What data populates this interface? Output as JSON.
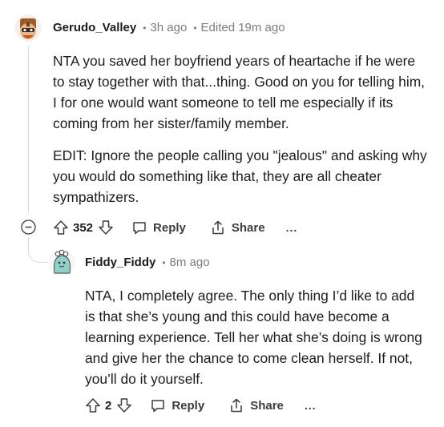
{
  "comment": {
    "author": "Gerudo_Valley",
    "age": "3h ago",
    "edited": "Edited 19m ago",
    "paragraphs": [
      "NTA you saved her boyfriend years of heartache if he were to stay together with that...thing. Good on you for telling him, I for one would want someone to tell me especially if its coming from her sister/family member.",
      "EDIT: Ignore the people calling you \"jealous\" and asking why you would do something like that, they are all cheater sympathizers."
    ],
    "votes": "352",
    "reply_label": "Reply",
    "share_label": "Share",
    "more_label": "..."
  },
  "reply": {
    "author": "Fiddy_Fiddy",
    "age": "8m ago",
    "paragraphs": [
      "NTA, I completely agree. The only thing I’d like to add is that she’s young and this could have become a learning experience. Tell her what she’s doing is wrong and give her the chance to come clean herself. If not, you’ll do it yourself."
    ],
    "votes": "2",
    "reply_label": "Reply",
    "share_label": "Share",
    "more_label": "..."
  },
  "icons": [
    "avatar",
    "upvote-icon",
    "downvote-icon",
    "reply-icon",
    "share-icon",
    "more-icon",
    "collapse-icon"
  ],
  "colors": {
    "meta": "#7c7c7c",
    "text": "#1c1c1c",
    "thread_line": "#d7dadc"
  }
}
